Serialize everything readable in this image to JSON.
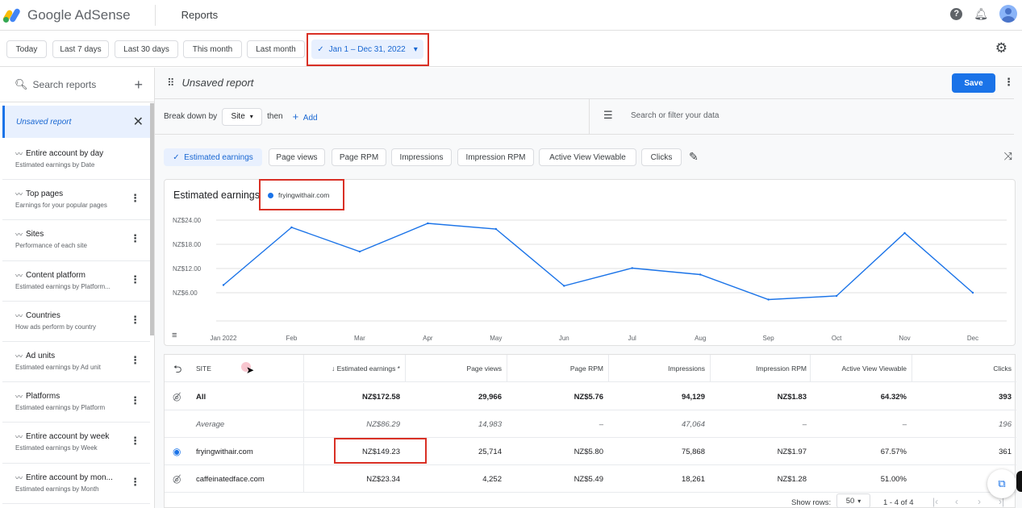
{
  "app": {
    "logo_text": "Google AdSense",
    "page_title": "Reports"
  },
  "date_chips": [
    "Today",
    "Last 7 days",
    "Last 30 days",
    "This month",
    "Last month"
  ],
  "date_range": {
    "check": "✓",
    "label": "Jan 1 – Dec 31, 2022",
    "caret": "▾"
  },
  "sidebar": {
    "search_placeholder": "Search reports",
    "unsaved_label": "Unsaved report",
    "items": [
      {
        "name": "Entire account by day",
        "desc": "Estimated earnings by Date"
      },
      {
        "name": "Top pages",
        "desc": "Earnings for your popular pages"
      },
      {
        "name": "Sites",
        "desc": "Performance of each site"
      },
      {
        "name": "Content platform",
        "desc": "Estimated earnings by Platform..."
      },
      {
        "name": "Countries",
        "desc": "How ads perform by country"
      },
      {
        "name": "Ad units",
        "desc": "Estimated earnings by Ad unit"
      },
      {
        "name": "Platforms",
        "desc": "Estimated earnings by Platform"
      },
      {
        "name": "Entire account by week",
        "desc": "Estimated earnings by Week"
      },
      {
        "name": "Entire account by mon...",
        "desc": "Estimated earnings by Month"
      }
    ]
  },
  "report": {
    "title": "Unsaved report",
    "save_label": "Save",
    "breakdown_label": "Break down by",
    "breakdown_value": "Site",
    "then_label": "then",
    "add_label": "Add",
    "filter_placeholder": "Search or filter your data"
  },
  "metrics": [
    {
      "label": "Estimated earnings",
      "active": true
    },
    {
      "label": "Page views",
      "active": false
    },
    {
      "label": "Page RPM",
      "active": false
    },
    {
      "label": "Impressions",
      "active": false
    },
    {
      "label": "Impression RPM",
      "active": false
    },
    {
      "label": "Active View Viewable",
      "active": false
    },
    {
      "label": "Clicks",
      "active": false
    }
  ],
  "chart_data": {
    "type": "line",
    "title": "Estimated earnings",
    "x": [
      "Jan 2022",
      "Feb",
      "Mar",
      "Apr",
      "May",
      "Jun",
      "Jul",
      "Aug",
      "Sep",
      "Oct",
      "Nov",
      "Dec"
    ],
    "series": [
      {
        "name": "fryingwithair.com",
        "color": "#1a73e8",
        "values": [
          7.9,
          22.2,
          16.2,
          23.2,
          21.8,
          7.7,
          12.1,
          10.5,
          4.3,
          5.2,
          20.8,
          6.0
        ]
      }
    ],
    "yticks": [
      "NZ$6.00",
      "NZ$12.00",
      "NZ$18.00",
      "NZ$24.00"
    ],
    "ytick_values": [
      6,
      12,
      18,
      24
    ],
    "ylim": [
      0,
      26
    ],
    "grid": true
  },
  "table": {
    "headers": {
      "site": "SITE",
      "earnings": "↓ Estimated earnings *",
      "page_views": "Page views",
      "page_rpm": "Page RPM",
      "impressions": "Impressions",
      "impression_rpm": "Impression RPM",
      "active_view": "Active View Viewable",
      "clicks": "Clicks"
    },
    "all": {
      "site": "All",
      "earnings": "NZ$172.58",
      "page_views": "29,966",
      "page_rpm": "NZ$5.76",
      "impressions": "94,129",
      "impression_rpm": "NZ$1.83",
      "active_view": "64.32%",
      "clicks": "393"
    },
    "average": {
      "site": "Average",
      "earnings": "NZ$86.29",
      "page_views": "14,983",
      "page_rpm": "–",
      "impressions": "47,064",
      "impression_rpm": "–",
      "active_view": "–",
      "clicks": "196"
    },
    "rows": [
      {
        "site": "fryingwithair.com",
        "earnings": "NZ$149.23",
        "page_views": "25,714",
        "page_rpm": "NZ$5.80",
        "impressions": "75,868",
        "impression_rpm": "NZ$1.97",
        "active_view": "67.57%",
        "clicks": "361",
        "visible": true
      },
      {
        "site": "caffeinatedface.com",
        "earnings": "NZ$23.34",
        "page_views": "4,252",
        "page_rpm": "NZ$5.49",
        "impressions": "18,261",
        "impression_rpm": "NZ$1.28",
        "active_view": "51.00%",
        "clicks": "",
        "visible": false
      }
    ]
  },
  "footer": {
    "show_rows_label": "Show rows:",
    "rows_value": "50",
    "range_label": "1 - 4 of 4"
  },
  "colors": {
    "accent": "#1a73e8",
    "highlight_box": "#d93025"
  }
}
